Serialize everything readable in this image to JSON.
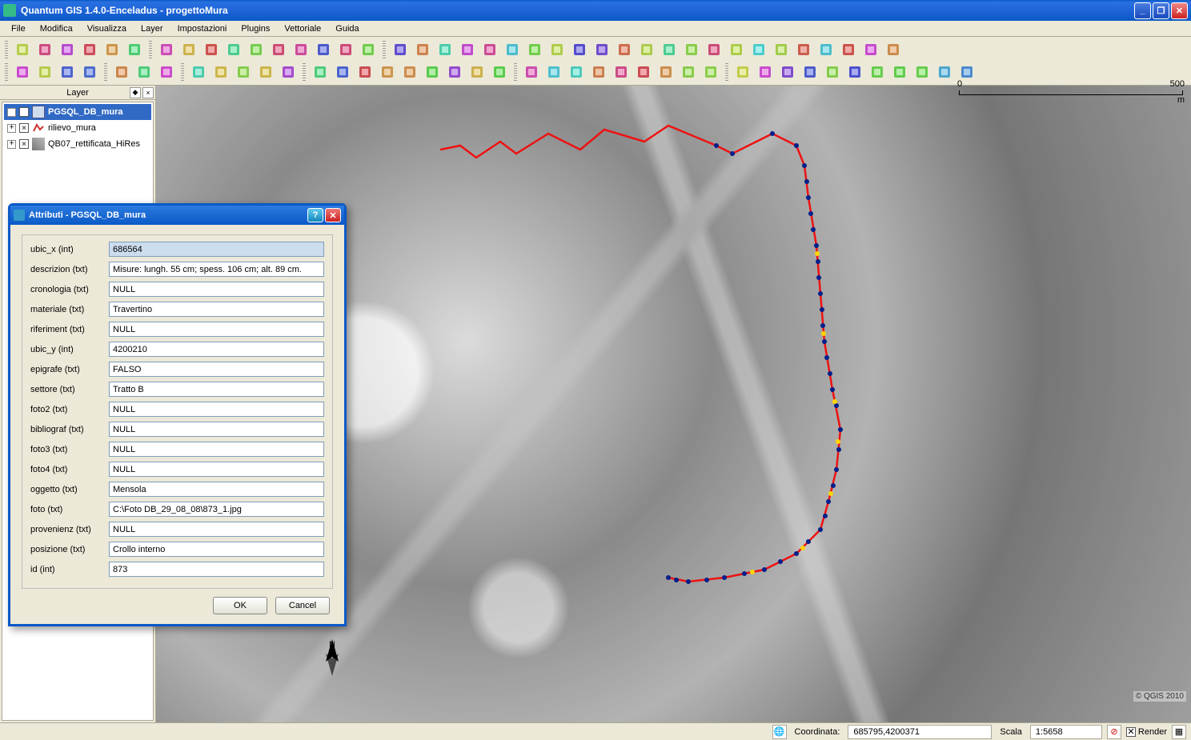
{
  "window": {
    "title": "Quantum GIS 1.4.0-Enceladus - progettoMura"
  },
  "menus": [
    "File",
    "Modifica",
    "Visualizza",
    "Layer",
    "Impostazioni",
    "Plugins",
    "Vettoriale",
    "Guida"
  ],
  "panel": {
    "title": "Layer"
  },
  "layers": [
    {
      "name": "PGSQL_DB_mura",
      "selected": true
    },
    {
      "name": "rilievo_mura",
      "selected": false
    },
    {
      "name": "QB07_rettificata_HiRes",
      "selected": false
    }
  ],
  "scalebar": {
    "left": "0",
    "right": "500",
    "unit": "m"
  },
  "credit": "© QGIS 2010",
  "status": {
    "coord_label": "Coordinata:",
    "coord_value": "685795,4200371",
    "scale_label": "Scala",
    "scale_value": "1:5658",
    "render_label": "Render"
  },
  "dialog": {
    "title": "Attributi - PGSQL_DB_mura",
    "ok": "OK",
    "cancel": "Cancel",
    "fields": [
      {
        "label": "ubic_x (int)",
        "value": "686564",
        "selected": true
      },
      {
        "label": "descrizion (txt)",
        "value": "Misure: lungh. 55 cm; spess. 106 cm; alt. 89 cm."
      },
      {
        "label": "cronologia (txt)",
        "value": "NULL"
      },
      {
        "label": "materiale (txt)",
        "value": "Travertino"
      },
      {
        "label": "riferiment (txt)",
        "value": "NULL"
      },
      {
        "label": "ubic_y (int)",
        "value": "4200210"
      },
      {
        "label": "epigrafe (txt)",
        "value": "FALSO"
      },
      {
        "label": "settore (txt)",
        "value": "Tratto B"
      },
      {
        "label": "foto2 (txt)",
        "value": "NULL"
      },
      {
        "label": "bibliograf (txt)",
        "value": "NULL"
      },
      {
        "label": "foto3 (txt)",
        "value": "NULL"
      },
      {
        "label": "foto4 (txt)",
        "value": "NULL"
      },
      {
        "label": "oggetto (txt)",
        "value": "Mensola"
      },
      {
        "label": "foto (txt)",
        "value": "C:\\Foto DB_29_08_08\\873_1.jpg"
      },
      {
        "label": "provenienz (txt)",
        "value": "NULL"
      },
      {
        "label": "posizione (txt)",
        "value": "Crollo interno"
      },
      {
        "label": "id (int)",
        "value": "873"
      }
    ]
  },
  "toolbar_icons_row1": [
    "new-project",
    "open-project",
    "save-project",
    "save-as",
    "print-composer",
    "print",
    "add-vector",
    "add-raster",
    "add-postgis",
    "add-wms",
    "add-spatialite",
    "new-shapefile",
    "remove-layer",
    "new-gpx",
    "wfs",
    "copyright",
    "scale-bar-plugin",
    "d2",
    "quick-print",
    "ftools",
    "raster-calc",
    "world",
    "metadata",
    "north-arrow-plugin",
    "gps",
    "plugin-1",
    "osm",
    "pdf",
    "delimited-text",
    "grass",
    "elephant",
    "python",
    "identify",
    "eye",
    "stats",
    "plugin-manager",
    "sql",
    "table",
    "select"
  ],
  "toolbar_icons_row2": [
    "identify-tool",
    "select-features",
    "deselect",
    "attribute-table",
    "open-table",
    "layer-props",
    "labels",
    "bookmarks",
    "home",
    "rect-select",
    "measure",
    "measure-area",
    "zoom-in",
    "zoom-out",
    "zoom-full",
    "zoom-selection",
    "zoom-layer",
    "zoom-last",
    "zoom-next",
    "refresh",
    "pencil",
    "node-tool",
    "move-feature",
    "vertex",
    "reshape",
    "split",
    "rotate",
    "simplify",
    "copy-features",
    "undo",
    "redo",
    "buffer",
    "clip",
    "union",
    "merge",
    "intersect",
    "symmetrical",
    "dissolve",
    "add-ring",
    "delete-ring",
    "add-part"
  ]
}
